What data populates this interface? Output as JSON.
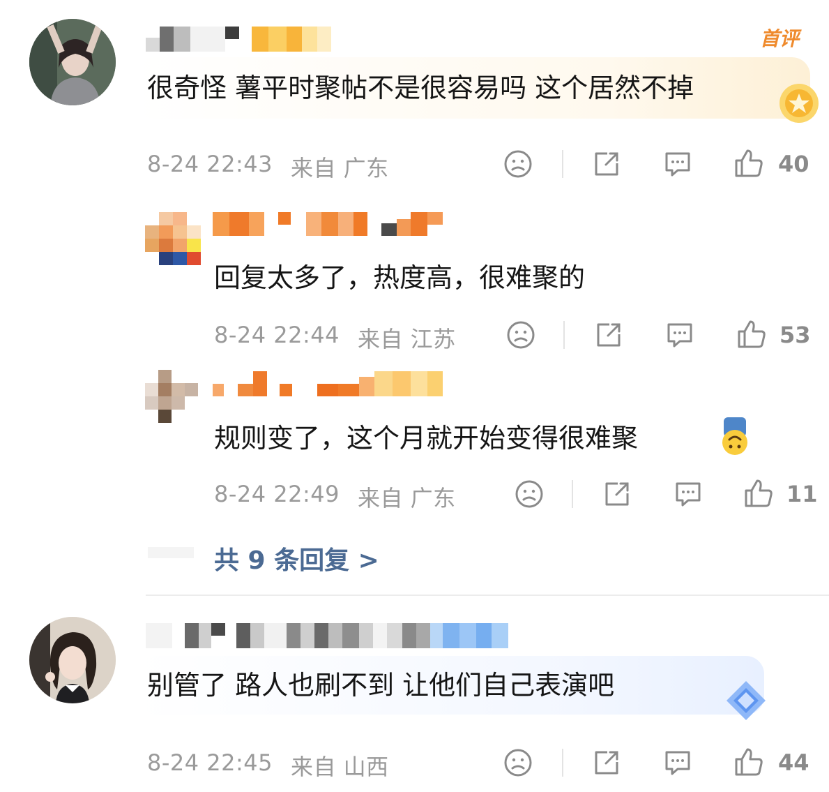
{
  "comments": [
    {
      "badge": "首评",
      "text": "很奇怪 薯平时聚帖不是很容易吗 这个居然不掉",
      "time": "8-24 22:43",
      "from": "来自 广东",
      "likes": "40",
      "replies": [
        {
          "text": "回复太多了，热度高，很难聚的",
          "time": "8-24 22:44",
          "from": "来自 江苏",
          "likes": "53"
        },
        {
          "text": "规则变了，这个月就开始变得很难聚",
          "time": "8-24 22:49",
          "from": "来自 广东",
          "likes": "11"
        }
      ],
      "more_replies": "共 9 条回复 >"
    },
    {
      "text": "别管了 路人也刷不到 让他们自己表演吧",
      "time": "8-24 22:45",
      "from": "来自 山西",
      "likes": "44"
    }
  ],
  "icons": {
    "dislike": "sad-face-icon",
    "share": "share-icon",
    "reply": "comment-bubble-icon",
    "like": "thumbs-up-icon"
  },
  "colors": {
    "meta_gray": "#9a9a9a",
    "link_blue": "#4b6a93",
    "badge_orange": "#ef8a2c"
  }
}
